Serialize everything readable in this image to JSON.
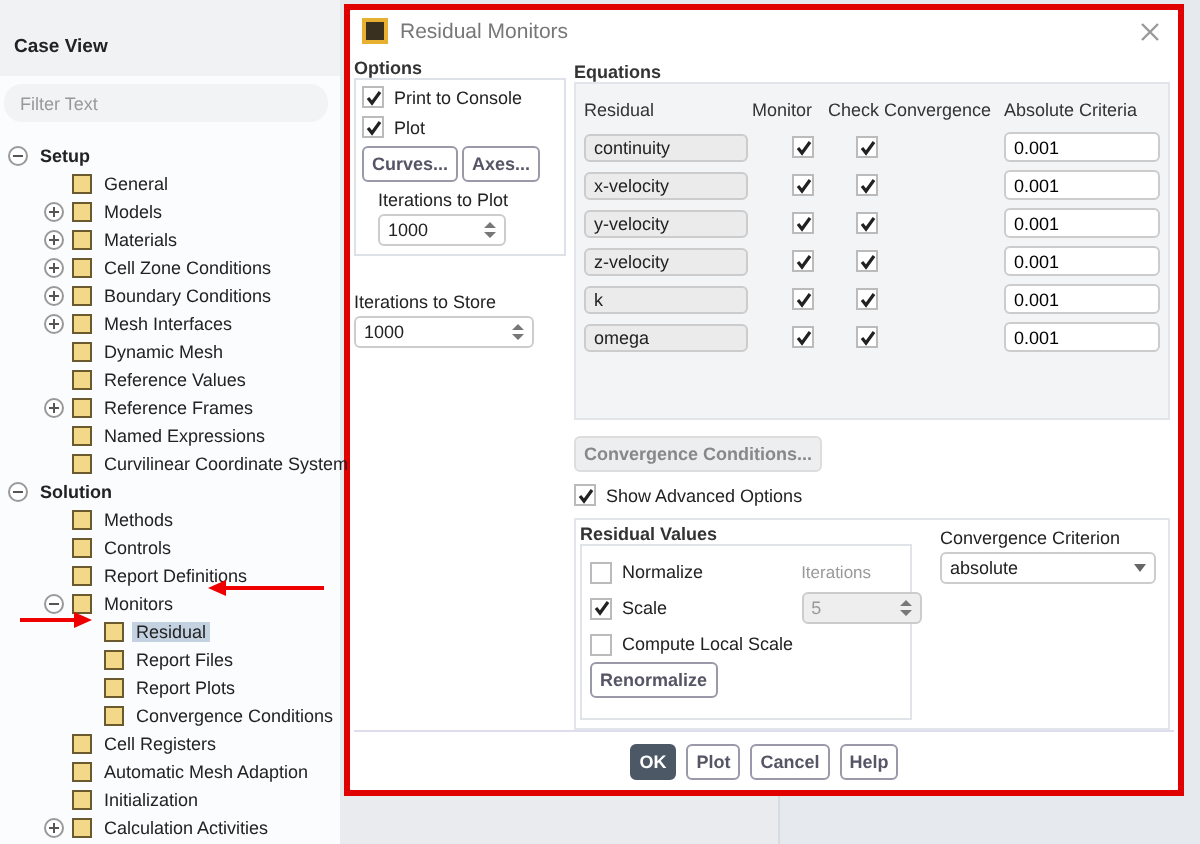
{
  "sidebar": {
    "title": "Case View",
    "filter": {
      "placeholder": "Filter Text"
    },
    "tree": [
      {
        "label": "Setup",
        "kind": "branch",
        "expanded": true,
        "selected": false,
        "children": [
          {
            "label": "General",
            "kind": "leaf",
            "selected": false
          },
          {
            "label": "Models",
            "kind": "branch",
            "expanded": false,
            "selected": false
          },
          {
            "label": "Materials",
            "kind": "branch",
            "expanded": false,
            "selected": false
          },
          {
            "label": "Cell Zone Conditions",
            "kind": "branch",
            "expanded": false,
            "selected": false
          },
          {
            "label": "Boundary Conditions",
            "kind": "branch",
            "expanded": false,
            "selected": false
          },
          {
            "label": "Mesh Interfaces",
            "kind": "branch",
            "expanded": false,
            "selected": false
          },
          {
            "label": "Dynamic Mesh",
            "kind": "leaf",
            "selected": false
          },
          {
            "label": "Reference Values",
            "kind": "leaf",
            "selected": false
          },
          {
            "label": "Reference Frames",
            "kind": "branch",
            "expanded": false,
            "selected": false
          },
          {
            "label": "Named Expressions",
            "kind": "leaf",
            "selected": false
          },
          {
            "label": "Curvilinear Coordinate System",
            "kind": "leaf",
            "selected": false
          }
        ]
      },
      {
        "label": "Solution",
        "kind": "branch",
        "expanded": true,
        "selected": false,
        "children": [
          {
            "label": "Methods",
            "kind": "leaf",
            "selected": false
          },
          {
            "label": "Controls",
            "kind": "leaf",
            "selected": false
          },
          {
            "label": "Report Definitions",
            "kind": "leaf",
            "selected": false
          },
          {
            "label": "Monitors",
            "kind": "branch",
            "expanded": true,
            "selected": false,
            "children": [
              {
                "label": "Residual",
                "kind": "leaf",
                "selected": true
              },
              {
                "label": "Report Files",
                "kind": "leaf",
                "selected": false
              },
              {
                "label": "Report Plots",
                "kind": "leaf",
                "selected": false
              },
              {
                "label": "Convergence Conditions",
                "kind": "leaf",
                "selected": false
              }
            ]
          },
          {
            "label": "Cell Registers",
            "kind": "leaf",
            "selected": false
          },
          {
            "label": "Automatic Mesh Adaption",
            "kind": "leaf",
            "selected": false
          },
          {
            "label": "Initialization",
            "kind": "leaf",
            "selected": false
          },
          {
            "label": "Calculation Activities",
            "kind": "branch",
            "expanded": false,
            "selected": false
          }
        ]
      }
    ]
  },
  "dialog": {
    "title": "Residual Monitors",
    "options": {
      "title": "Options",
      "checks": [
        {
          "label": "Print to Console",
          "checked": true
        },
        {
          "label": "Plot",
          "checked": true
        }
      ],
      "buttons": [
        "Curves...",
        "Axes..."
      ],
      "iterations_to_plot": {
        "label": "Iterations to Plot",
        "value": "1000"
      }
    },
    "iterations_to_store": {
      "label": "Iterations to Store",
      "value": "1000"
    },
    "equations": {
      "title": "Equations",
      "columns": [
        "Residual",
        "Monitor",
        "Check Convergence",
        "Absolute Criteria"
      ],
      "rows": [
        {
          "residual": "continuity",
          "monitor": true,
          "check_convergence": true,
          "absolute_criteria": "0.001"
        },
        {
          "residual": "x-velocity",
          "monitor": true,
          "check_convergence": true,
          "absolute_criteria": "0.001"
        },
        {
          "residual": "y-velocity",
          "monitor": true,
          "check_convergence": true,
          "absolute_criteria": "0.001"
        },
        {
          "residual": "z-velocity",
          "monitor": true,
          "check_convergence": true,
          "absolute_criteria": "0.001"
        },
        {
          "residual": "k",
          "monitor": true,
          "check_convergence": true,
          "absolute_criteria": "0.001"
        },
        {
          "residual": "omega",
          "monitor": true,
          "check_convergence": true,
          "absolute_criteria": "0.001"
        }
      ]
    },
    "convergence_conditions_button": {
      "label": "Convergence Conditions...",
      "disabled": true
    },
    "show_advanced": {
      "label": "Show Advanced Options",
      "checked": true
    },
    "residual_values": {
      "title": "Residual Values",
      "checks": [
        {
          "label": "Normalize",
          "checked": false
        },
        {
          "label": "Scale",
          "checked": true
        },
        {
          "label": "Compute Local Scale",
          "checked": false
        }
      ],
      "iterations": {
        "label": "Iterations",
        "value": "5",
        "disabled": true
      },
      "button": "Renormalize"
    },
    "convergence_criterion": {
      "label": "Convergence Criterion",
      "value": "absolute"
    },
    "footer_buttons": [
      {
        "label": "OK",
        "primary": true
      },
      {
        "label": "Plot",
        "primary": false
      },
      {
        "label": "Cancel",
        "primary": false
      },
      {
        "label": "Help",
        "primary": false
      }
    ]
  }
}
